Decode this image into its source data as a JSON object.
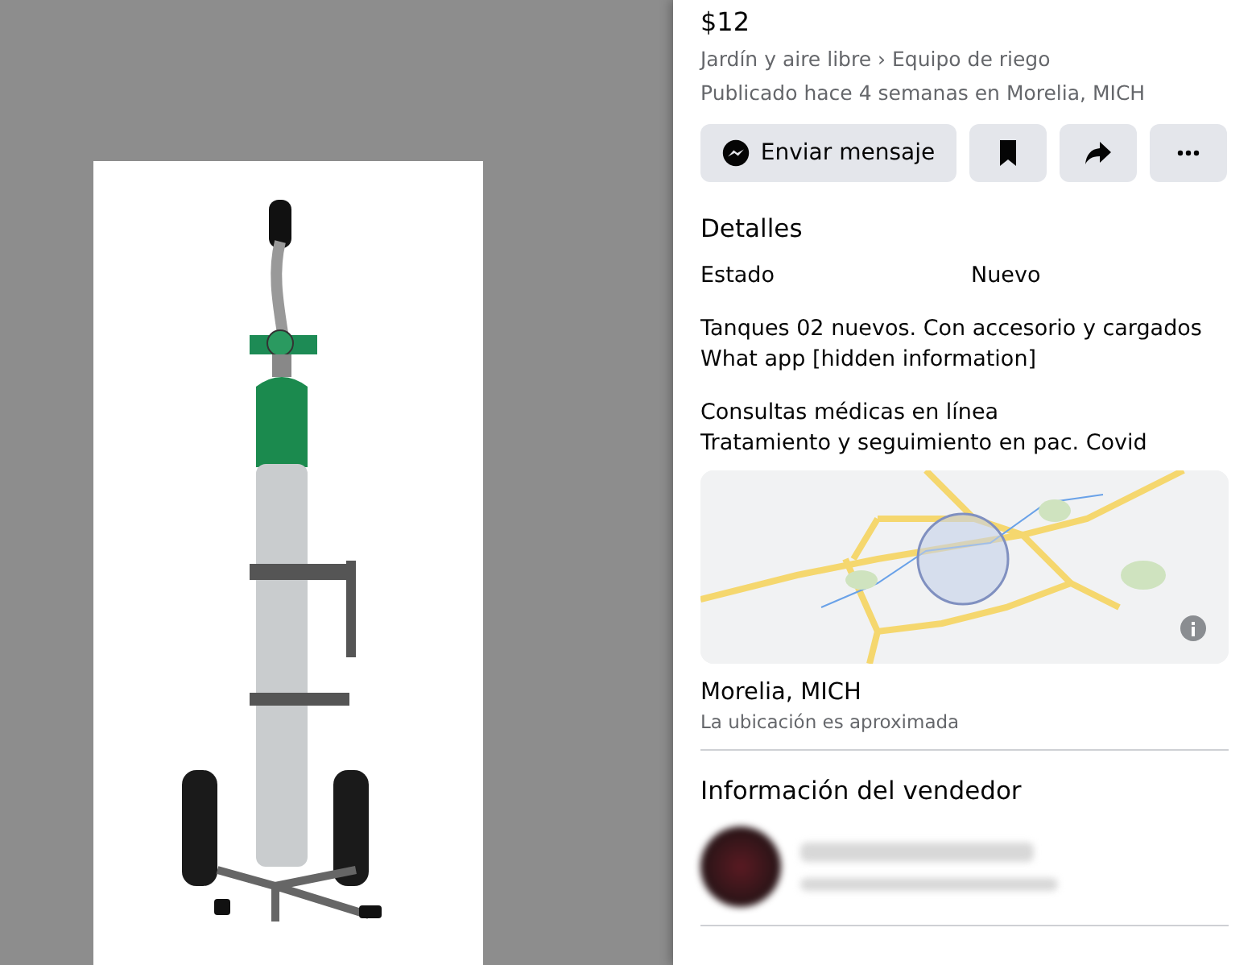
{
  "listing": {
    "price": "$12",
    "category_path": "Jardín y aire libre › Equipo de riego",
    "posted": "Publicado hace 4 semanas en Morelia, MICH"
  },
  "actions": [
    {
      "kind": "message",
      "label": "Enviar mensaje"
    },
    {
      "kind": "save"
    },
    {
      "kind": "share"
    },
    {
      "kind": "more"
    }
  ],
  "details": {
    "title": "Detalles",
    "attributes": [
      {
        "label": "Estado",
        "value": "Nuevo"
      }
    ],
    "description": [
      [
        "Tanques 02 nuevos. Con accesorio y cargados",
        "What app [hidden information]"
      ],
      [
        "Consultas médicas en línea",
        "Tratamiento y seguimiento en pac. Covid"
      ]
    ]
  },
  "location": {
    "name": "Morelia, MICH",
    "note": "La ubicación es aproximada"
  },
  "seller": {
    "title": "Información del vendedor"
  }
}
